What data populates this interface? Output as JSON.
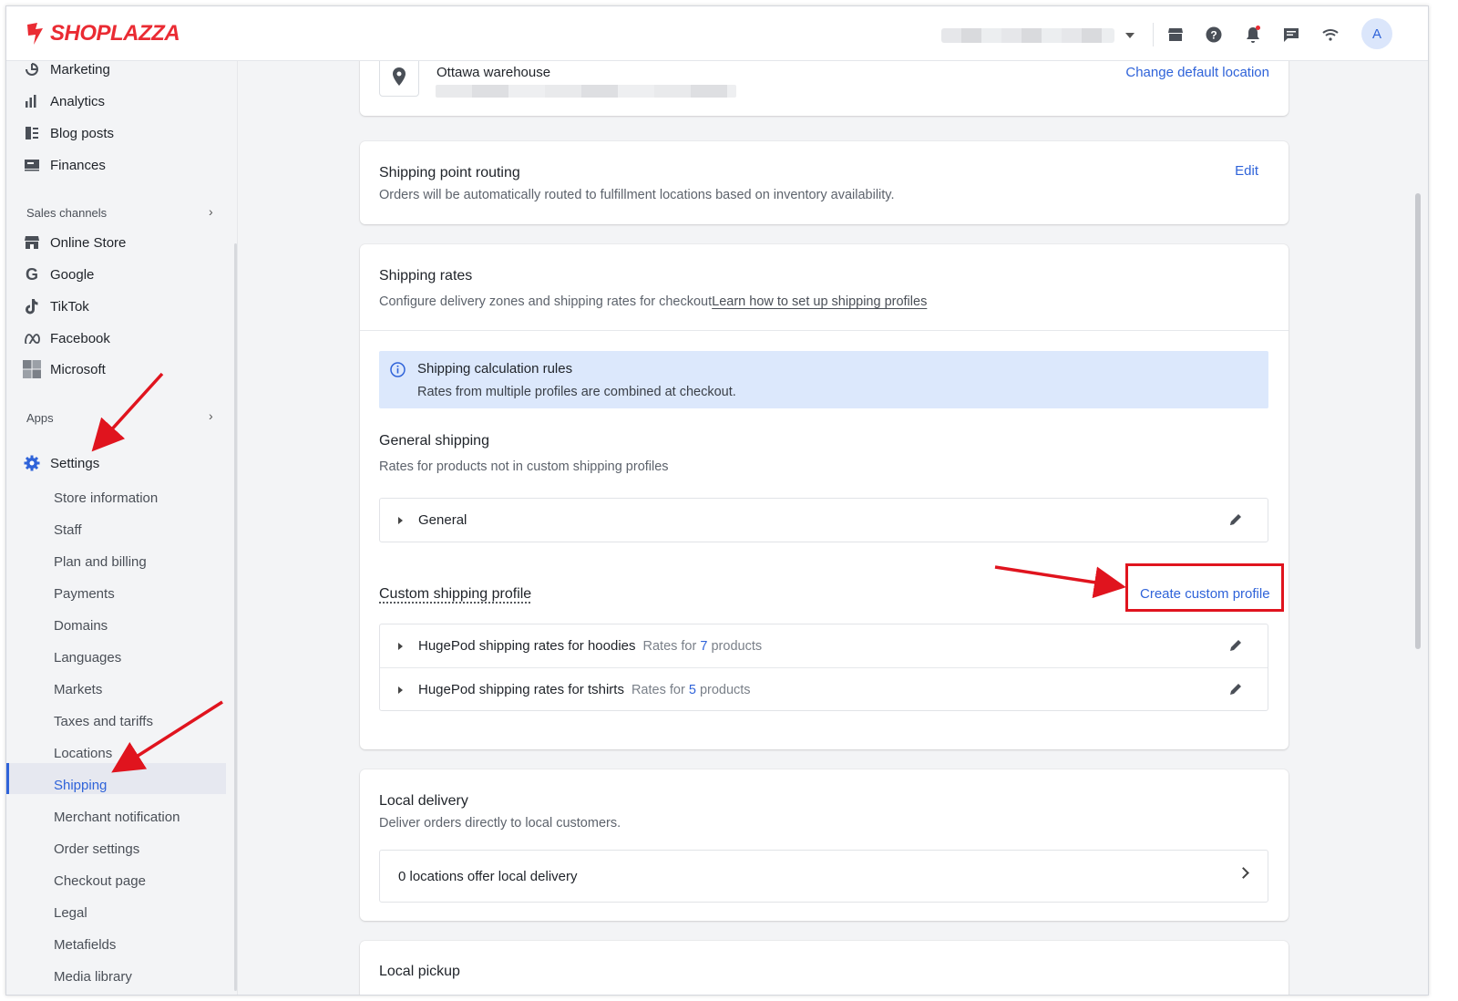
{
  "brand": {
    "name": "SHOPLAZZA",
    "color": "#ea2b33"
  },
  "accent": "#2f63d9",
  "topbar": {
    "icons": [
      "store-icon",
      "help-icon",
      "bell-icon",
      "chat-icon",
      "wifi-icon"
    ],
    "avatar_initial": "A"
  },
  "sidebar": {
    "main_items": [
      {
        "label": "Marketing",
        "icon": "marketing-icon"
      },
      {
        "label": "Analytics",
        "icon": "analytics-icon"
      },
      {
        "label": "Blog posts",
        "icon": "blog-icon"
      },
      {
        "label": "Finances",
        "icon": "finances-icon"
      }
    ],
    "sales_channels_label": "Sales channels",
    "channels": [
      {
        "label": "Online Store",
        "icon": "store-icon"
      },
      {
        "label": "Google",
        "icon": "google-icon"
      },
      {
        "label": "TikTok",
        "icon": "tiktok-icon"
      },
      {
        "label": "Facebook",
        "icon": "meta-icon"
      },
      {
        "label": "Microsoft",
        "icon": "microsoft-icon"
      }
    ],
    "apps_label": "Apps",
    "settings_label": "Settings",
    "settings_items": [
      "Store information",
      "Staff",
      "Plan and billing",
      "Payments",
      "Domains",
      "Languages",
      "Markets",
      "Taxes and tariffs",
      "Locations",
      "Shipping",
      "Merchant notification",
      "Order settings",
      "Checkout page",
      "Legal",
      "Metafields",
      "Media library"
    ],
    "active_item": "Shipping"
  },
  "main": {
    "location": {
      "name": "Ottawa warehouse",
      "change_link": "Change default location"
    },
    "routing": {
      "title": "Shipping point routing",
      "desc": "Orders will be automatically routed to fulfillment locations based on inventory availability.",
      "edit": "Edit"
    },
    "rates": {
      "title": "Shipping rates",
      "desc": "Configure delivery zones and shipping rates for checkout",
      "learn_link": "Learn how to set up shipping profiles",
      "info_title": "Shipping calculation rules",
      "info_text": "Rates from multiple profiles are combined at checkout.",
      "general_title": "General shipping",
      "general_desc": "Rates for products not in custom shipping profiles",
      "general_profile": "General",
      "custom_title": "Custom shipping profile",
      "create_link": "Create custom profile",
      "profiles": [
        {
          "name": "HugePod shipping rates for hoodies",
          "prefix": "Rates for",
          "count": "7",
          "suffix": "products"
        },
        {
          "name": "HugePod shipping rates for tshirts",
          "prefix": "Rates for",
          "count": "5",
          "suffix": "products"
        }
      ]
    },
    "local_delivery": {
      "title": "Local delivery",
      "desc": "Deliver orders directly to local customers.",
      "row": "0 locations offer local delivery"
    },
    "local_pickup": {
      "title": "Local pickup"
    }
  },
  "annotation_color": "#e0141e"
}
